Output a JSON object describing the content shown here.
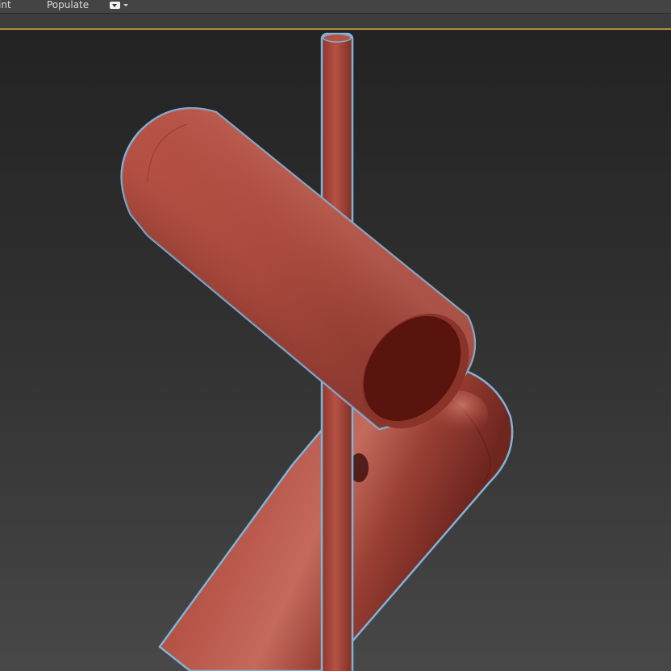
{
  "toolbar": {
    "paint_label": "int",
    "populate_label": "Populate"
  },
  "viewport": {
    "border_color": "#b18c3f",
    "object_color": "#a5473b",
    "selection_outline_color": "#7fb3d8",
    "background_top": "#232323",
    "background_bottom": "#484848"
  },
  "icons": {
    "viewport_menu": "dropdown-icon"
  }
}
